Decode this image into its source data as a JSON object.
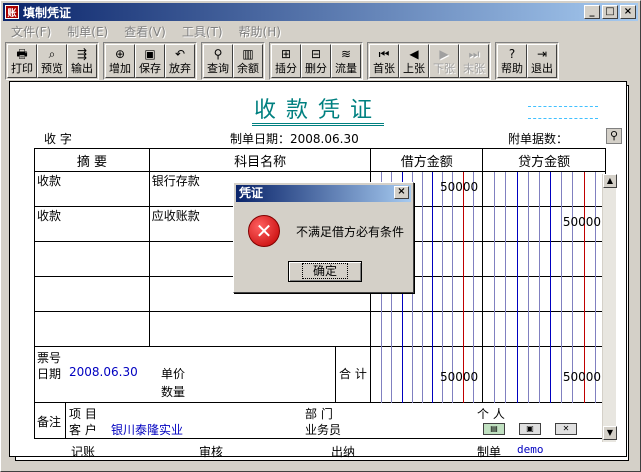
{
  "window": {
    "title": "填制凭证",
    "app_icon": "ledger-icon",
    "controls": [
      "minimize-icon",
      "maximize-icon",
      "close-icon"
    ]
  },
  "menu": [
    {
      "label": "文件(F)"
    },
    {
      "label": "制单(E)"
    },
    {
      "label": "查看(V)"
    },
    {
      "label": "工具(T)"
    },
    {
      "label": "帮助(H)"
    }
  ],
  "toolbar": {
    "groups": [
      [
        {
          "label": "打印",
          "icon": "printer-icon",
          "glyph": "🖶",
          "enabled": true
        },
        {
          "label": "预览",
          "icon": "preview-icon",
          "glyph": "⌕",
          "enabled": true
        },
        {
          "label": "输出",
          "icon": "export-icon",
          "glyph": "⇶",
          "enabled": true
        }
      ],
      [
        {
          "label": "增加",
          "icon": "add-icon",
          "glyph": "⊕",
          "enabled": true
        },
        {
          "label": "保存",
          "icon": "save-icon",
          "glyph": "▣",
          "enabled": true
        },
        {
          "label": "放弃",
          "icon": "undo-icon",
          "glyph": "↶",
          "enabled": true
        }
      ],
      [
        {
          "label": "查询",
          "icon": "binoculars-icon",
          "glyph": "⚲",
          "enabled": true
        },
        {
          "label": "余额",
          "icon": "balance-chart-icon",
          "glyph": "▥",
          "enabled": true
        }
      ],
      [
        {
          "label": "插分",
          "icon": "insert-row-icon",
          "glyph": "⊞",
          "enabled": true
        },
        {
          "label": "删分",
          "icon": "delete-row-icon",
          "glyph": "⊟",
          "enabled": true
        },
        {
          "label": "流量",
          "icon": "cashflow-icon",
          "glyph": "≋",
          "enabled": true
        }
      ],
      [
        {
          "label": "首张",
          "icon": "first-record-icon",
          "glyph": "⏮",
          "enabled": true
        },
        {
          "label": "上张",
          "icon": "prev-record-icon",
          "glyph": "◀",
          "enabled": true
        },
        {
          "label": "下张",
          "icon": "next-record-icon",
          "glyph": "▶",
          "enabled": false
        },
        {
          "label": "末张",
          "icon": "last-record-icon",
          "glyph": "⏭",
          "enabled": false
        }
      ],
      [
        {
          "label": "帮助",
          "icon": "help-icon",
          "glyph": "?",
          "enabled": true
        },
        {
          "label": "退出",
          "icon": "exit-icon",
          "glyph": "⇥",
          "enabled": true
        }
      ]
    ]
  },
  "voucher": {
    "title": "收款凭证",
    "voucher_type_label": "收 字",
    "date_label": "制单日期：",
    "date": "2008.06.30",
    "attachments_label": "附单据数：",
    "columns": {
      "summary": "摘 要",
      "account": "科目名称",
      "debit": "借方金额",
      "credit": "贷方金额"
    },
    "rows": [
      {
        "summary": "收款",
        "account": "银行存款",
        "debit": "50000",
        "credit": ""
      },
      {
        "summary": "收款",
        "account": "应收账款",
        "debit": "",
        "credit": "50000"
      },
      {
        "summary": "",
        "account": "",
        "debit": "",
        "credit": ""
      },
      {
        "summary": "",
        "account": "",
        "debit": "",
        "credit": ""
      },
      {
        "summary": "",
        "account": "",
        "debit": "",
        "credit": ""
      }
    ],
    "bill_no_label": "票号",
    "bill_date_label": "日期",
    "bill_date": "2008.06.30",
    "unit_price_label": "单价",
    "quantity_label": "数量",
    "total_label": "合 计",
    "total_debit": "50000",
    "total_credit": "50000",
    "remarks_label": "备注",
    "project_label": "项 目",
    "department_label": "部 门",
    "person_label": "个 人",
    "customer_label": "客 户",
    "customer": "银川泰隆实业",
    "salesperson_label": "业务员",
    "bookkeeper_label": "记账",
    "auditor_label": "审核",
    "cashier_label": "出纳",
    "maker_label": "制单",
    "maker": "demo"
  },
  "dialog": {
    "title": "凭证",
    "message": "不满足借方必有条件",
    "ok_label": "确定"
  }
}
